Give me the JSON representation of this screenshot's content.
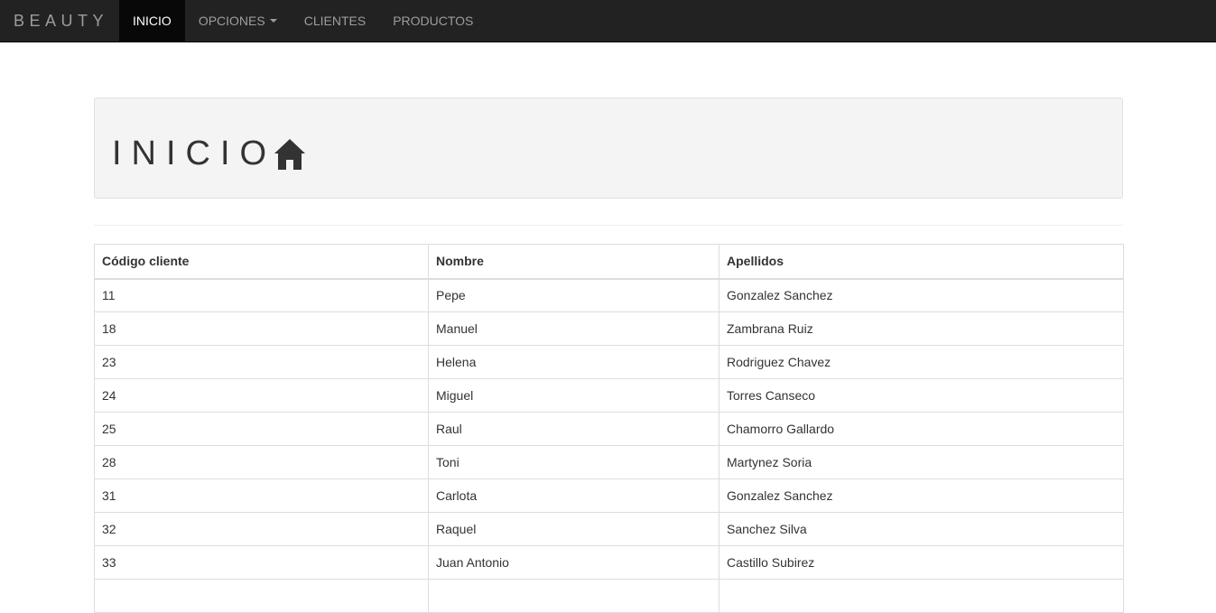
{
  "navbar": {
    "brand": "BEAUTY",
    "items": [
      {
        "label": "INICIO",
        "active": true
      },
      {
        "label": "OPCIONES",
        "dropdown": true
      },
      {
        "label": "CLIENTES"
      },
      {
        "label": "PRODUCTOS"
      }
    ]
  },
  "header": {
    "title": "INICIO",
    "icon": "home-icon"
  },
  "table": {
    "columns": [
      "Código cliente",
      "Nombre",
      "Apellidos"
    ],
    "rows": [
      [
        "11",
        "Pepe",
        "Gonzalez Sanchez"
      ],
      [
        "18",
        "Manuel",
        "Zambrana Ruiz"
      ],
      [
        "23",
        "Helena",
        "Rodriguez Chavez"
      ],
      [
        "24",
        "Miguel",
        "Torres Canseco"
      ],
      [
        "25",
        "Raul",
        "Chamorro Gallardo"
      ],
      [
        "28",
        "Toni",
        "Martynez Soria"
      ],
      [
        "31",
        "Carlota",
        "Gonzalez Sanchez"
      ],
      [
        "32",
        "Raquel",
        "Sanchez Silva"
      ],
      [
        "33",
        "Juan Antonio",
        "Castillo Subirez"
      ],
      [
        "",
        "",
        ""
      ]
    ]
  },
  "colors": {
    "navbar_bg": "#222222",
    "navbar_active_bg": "#080808",
    "navbar_text": "#9d9d9d",
    "jumbotron_bg": "#f4f4f4",
    "border": "#dddddd"
  }
}
